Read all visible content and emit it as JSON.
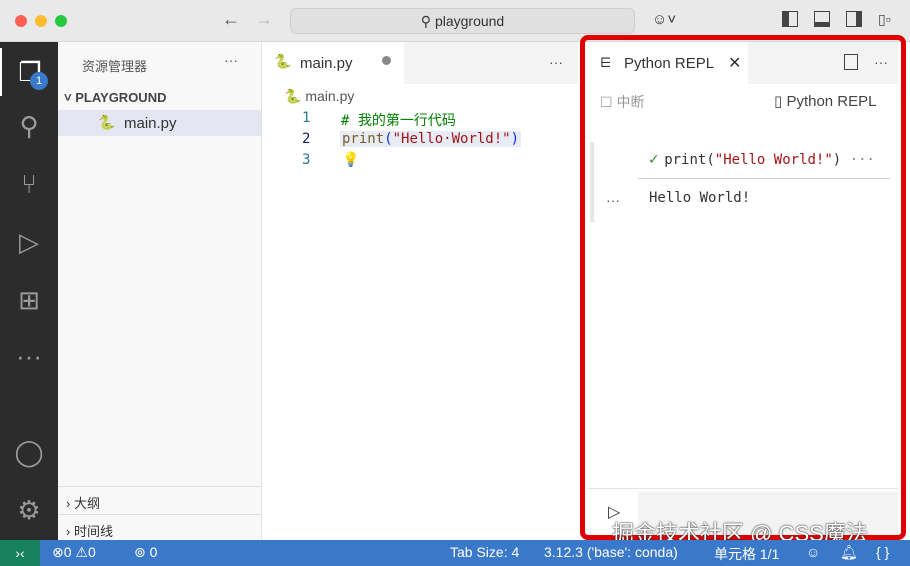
{
  "titlebar": {
    "search": "playground",
    "back": "←",
    "forward": "→"
  },
  "sidebar": {
    "title": "资源管理器",
    "more": "···",
    "folder": "PLAYGROUND",
    "file": "main.py",
    "outline": "大纲",
    "timeline": "时间线"
  },
  "activity": {
    "badge": "1"
  },
  "editor": {
    "tab": "main.py",
    "more": "···",
    "breadcrumb": "main.py",
    "lines": [
      {
        "n": "1",
        "comment": "# 我的第一行代码"
      },
      {
        "n": "2",
        "fn": "print",
        "open": "(",
        "str": "\"Hello·World!\"",
        "close": ")"
      },
      {
        "n": "3"
      }
    ]
  },
  "panel": {
    "tab": "Python REPL",
    "interrupt": "中断",
    "kernel": "Python REPL",
    "more": "···",
    "cell": {
      "fn": "print",
      "open": "(",
      "str": "\"Hello World!\"",
      "close": ")",
      "more": "···"
    },
    "output": "Hello World!",
    "output_more": "···"
  },
  "watermark": "掘金技术社区 @ CSS魔法",
  "status": {
    "errors": "0",
    "warnings": "0",
    "ports": "0",
    "tab_size": "Tab Size: 4",
    "interpreter": "3.12.3 ('base': conda)",
    "cells": "单元格 1/1"
  },
  "colors": {
    "accent": "#3a78c9",
    "frame": "#e00000",
    "remote": "#16825d"
  }
}
